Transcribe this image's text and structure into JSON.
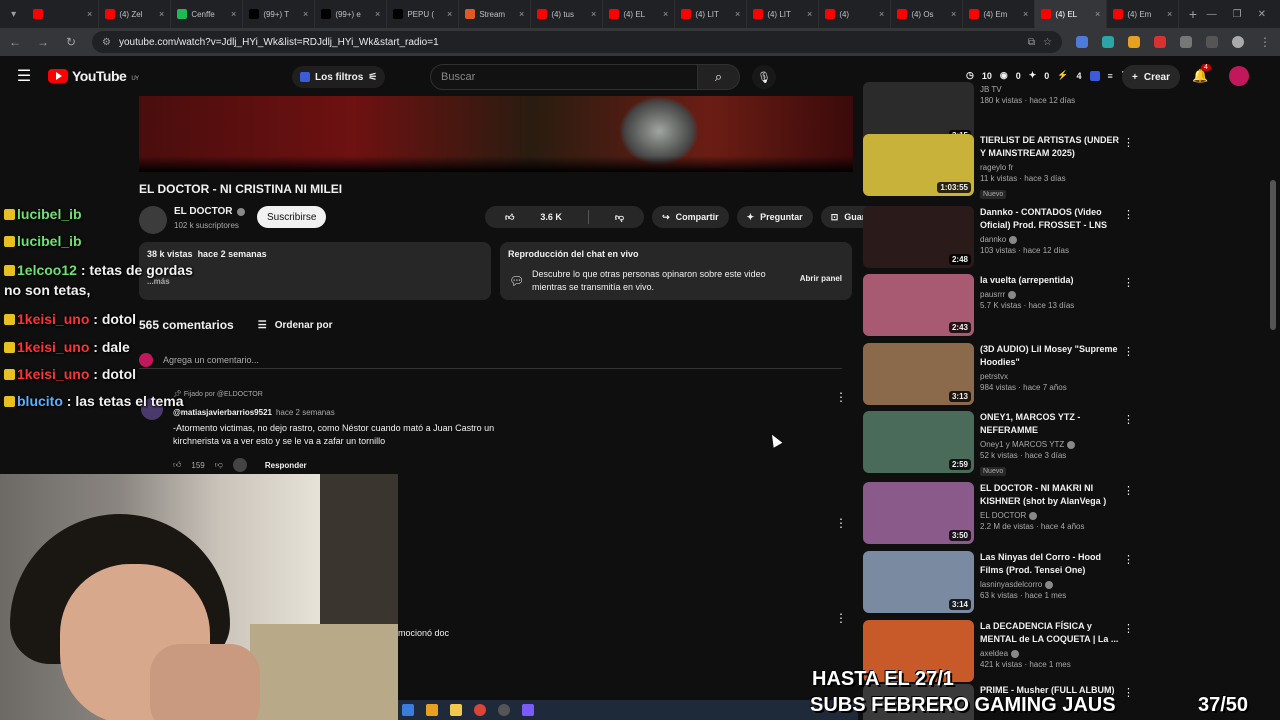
{
  "browser": {
    "tabs": [
      {
        "label": "",
        "color": "#ff0000"
      },
      {
        "label": "(4) Zel",
        "color": "#ff0000"
      },
      {
        "label": "Cenffe",
        "color": "#1db954"
      },
      {
        "label": "(99+) T",
        "color": "#000000"
      },
      {
        "label": "(99+) e",
        "color": "#000000"
      },
      {
        "label": "PEPU (",
        "color": "#000000"
      },
      {
        "label": "Stream",
        "color": "#e25822"
      },
      {
        "label": "(4) tus",
        "color": "#ff0000"
      },
      {
        "label": "(4) EL",
        "color": "#ff0000"
      },
      {
        "label": "(4) LIT",
        "color": "#ff0000"
      },
      {
        "label": "(4) LIT",
        "color": "#ff0000"
      },
      {
        "label": "(4)",
        "color": "#ff0000"
      },
      {
        "label": "(4) Os",
        "color": "#ff0000"
      },
      {
        "label": "(4) Em",
        "color": "#ff0000"
      },
      {
        "label": "(4) EL",
        "color": "#ff0000"
      },
      {
        "label": "(4) Em",
        "color": "#ff0000"
      }
    ],
    "active_tab_index": 14,
    "url": "youtube.com/watch?v=Jdlj_HYi_Wk&list=RDJdlj_HYi_Wk&start_radio=1"
  },
  "header": {
    "logo_text": "YouTube",
    "logo_region": "UY",
    "filters_label": "Los filtros",
    "search_placeholder": "Buscar",
    "stats": [
      "10",
      "0",
      "0",
      "4"
    ],
    "create_label": "Crear",
    "notifications_count": "4"
  },
  "video": {
    "title": "EL DOCTOR - NI CRISTINA NI MILEI",
    "channel": "EL DOCTOR",
    "subscribers": "102 k suscriptores",
    "subscribe_label": "Suscribirse",
    "likes": "3.6 K",
    "share_label": "Compartir",
    "ask_label": "Preguntar",
    "save_label": "Guardar",
    "description": {
      "views": "38 k vistas",
      "ago": "hace 2 semanas",
      "more": "...más"
    },
    "livechat": {
      "title": "Reproducción del chat en vivo",
      "desc": "Descubre lo que otras personas opinaron sobre este video mientras se transmitía en vivo.",
      "open_label": "Abrir panel"
    }
  },
  "comments": {
    "count": "565 comentarios",
    "sort_label": "Ordenar por",
    "add_placeholder": "Agrega un comentario...",
    "pinned": {
      "pinned_label": "Fijado por @ELDOCTOR",
      "author": "@matiasjavierbarrios9521",
      "ago": "hace 2 semanas",
      "body": "-Atormento victimas, no dejo rastro, como Néstor cuando mató a Juan Castro un kirchnerista va a ver esto y se le va a zafar un tornillo",
      "likes": "159",
      "reply_label": "Responder"
    },
    "partial_text": "mocionó doc"
  },
  "sidebar": {
    "items": [
      {
        "title": "",
        "channel": "JB TV",
        "meta": "180 k vistas · hace 12 días",
        "duration": "3:15",
        "verified": false,
        "new": false,
        "thumb": "#2b2b2b"
      },
      {
        "title": "TIERLIST DE ARTISTAS (UNDER Y MAINSTREAM 2025)",
        "channel": "rageylo fr",
        "meta": "11 k vistas · hace 3 días",
        "duration": "1:03:55",
        "verified": false,
        "new": true,
        "thumb": "#c9b23a"
      },
      {
        "title": "Dannko - CONTADOS (Video Oficial) Prod. FROSSET - LNS",
        "channel": "dannko",
        "meta": "103 vistas · hace 12 días",
        "duration": "2:48",
        "verified": true,
        "new": false,
        "thumb": "#2a1a1a"
      },
      {
        "title": "la vuelta (arrepentida)",
        "channel": "pausrrr",
        "meta": "5.7 K vistas · hace 13 días",
        "duration": "2:43",
        "verified": true,
        "new": false,
        "thumb": "#a85a72"
      },
      {
        "title": "(3D AUDIO) Lil Mosey \"Supreme Hoodies\"",
        "channel": "petrstvx",
        "meta": "984 vistas · hace 7 años",
        "duration": "3:13",
        "verified": false,
        "new": false,
        "thumb": "#8a6a4a"
      },
      {
        "title": "ONEY1, MARCOS YTZ - NEFERAMME",
        "channel": "Oney1 y MARCOS YTZ",
        "meta": "52 k vistas · hace 3 días",
        "duration": "2:59",
        "verified": true,
        "new": true,
        "thumb": "#4a6a5a"
      },
      {
        "title": "EL DOCTOR - NI MAKRI NI KISHNER (shot by AlanVega )",
        "channel": "EL DOCTOR",
        "meta": "2.2 M de vistas · hace 4 años",
        "duration": "3:50",
        "verified": true,
        "new": false,
        "thumb": "#8a5a8a"
      },
      {
        "title": "Las Ninyas del Corro - Hood Films (Prod. Tensei One)",
        "channel": "lasninyasdelcorro",
        "meta": "63 k vistas · hace 1 mes",
        "duration": "3:14",
        "verified": true,
        "new": false,
        "thumb": "#7a8aa0"
      },
      {
        "title": "La DECADENCIA FÍSICA y MENTAL de LA COQUETA | La ...",
        "channel": "axeldea",
        "meta": "421 k vistas · hace 1 mes",
        "duration": "",
        "verified": true,
        "new": false,
        "thumb": "#c85a2a"
      },
      {
        "title": "PRIME - Musher (FULL ALBUM)",
        "channel": "",
        "meta": "",
        "duration": "",
        "verified": false,
        "new": false,
        "thumb": "#3a3a3a"
      }
    ]
  },
  "stream_chat": [
    {
      "user": "lucibel_ib",
      "msg": "",
      "color": "#6ee16e"
    },
    {
      "user": "lucibel_ib",
      "msg": "",
      "color": "#6ee16e"
    },
    {
      "user": "1elcoo12",
      "msg": "tetas de gordas no son tetas,",
      "color": "#6ee16e"
    },
    {
      "user": "1keisi_uno",
      "msg": "dotol",
      "color": "#ff3333"
    },
    {
      "user": "1keisi_uno",
      "msg": "dale",
      "color": "#ff3333"
    },
    {
      "user": "1keisi_uno",
      "msg": "dotol",
      "color": "#ff3333"
    },
    {
      "user": "blucito",
      "msg": "las tetas el tema",
      "color": "#5bb0ff"
    }
  ],
  "overlay": {
    "date_text": "HASTA EL 27/1",
    "subs_text": "SUBS FEBRERO GAMING JAUS",
    "subs_goal": "37/50"
  }
}
